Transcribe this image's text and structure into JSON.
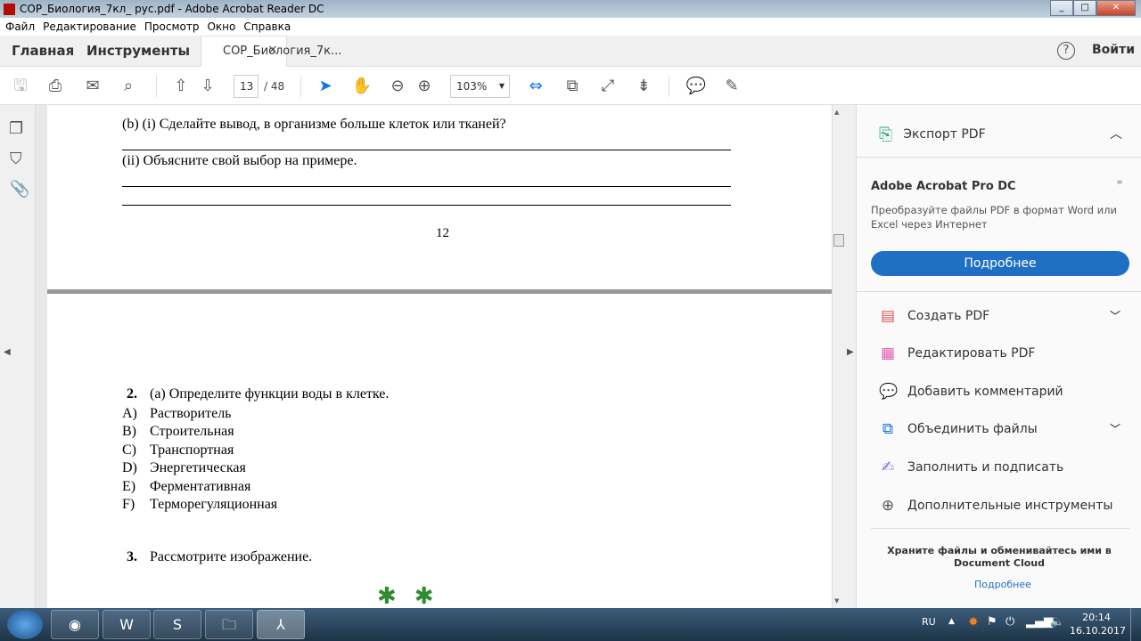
{
  "window": {
    "title": "СОР_Биология_7кл_ рус.pdf - Adobe Acrobat Reader DC",
    "min": "_",
    "max": "□",
    "close": "✕"
  },
  "menu": [
    "Файл",
    "Редактирование",
    "Просмотр",
    "Окно",
    "Справка"
  ],
  "tabs": {
    "home": "Главная",
    "tools": "Инструменты",
    "doc": "СОР_Биология_7к...",
    "close": "×",
    "help": "?",
    "signin": "Войти"
  },
  "toolbar": {
    "page": "13",
    "total": "/ 48",
    "zoom": "103%"
  },
  "page1": {
    "q_b_i": "(b) (i) Сделайте вывод, в организме больше клеток или тканей?",
    "q_b_ii": "(ii) Объясните свой выбор на примере.",
    "page_number": "12"
  },
  "page2": {
    "q2_num": "2.",
    "q2": "(а) Определите функции воды в клетке.",
    "options": [
      {
        "l": "A)",
        "t": "Растворитель"
      },
      {
        "l": "B)",
        "t": "Строительная"
      },
      {
        "l": "C)",
        "t": "Транспортная"
      },
      {
        "l": "D)",
        "t": "Энергетическая"
      },
      {
        "l": "E)",
        "t": "Ферментативная"
      },
      {
        "l": "F)",
        "t": "Терморегуляционная"
      }
    ],
    "q3_num": "3.",
    "q3": "Рассмотрите изображение."
  },
  "panel": {
    "export": "Экспорт PDF",
    "promo_title": "Adobe Acrobat Pro DC",
    "promo_text": "Преобразуйте файлы PDF в формат Word или Excel через Интернет",
    "promo_button": "Подробнее",
    "tools": [
      "Создать PDF",
      "Редактировать PDF",
      "Добавить комментарий",
      "Объединить файлы",
      "Заполнить и подписать",
      "Дополнительные инструменты"
    ],
    "cloud_text": "Храните файлы и обменивайтесь ими в Document Cloud",
    "cloud_link": "Подробнее"
  },
  "tray": {
    "lang": "RU",
    "time": "20:14",
    "date": "16.10.2017"
  },
  "colors": {
    "accent": "#1473e6"
  }
}
